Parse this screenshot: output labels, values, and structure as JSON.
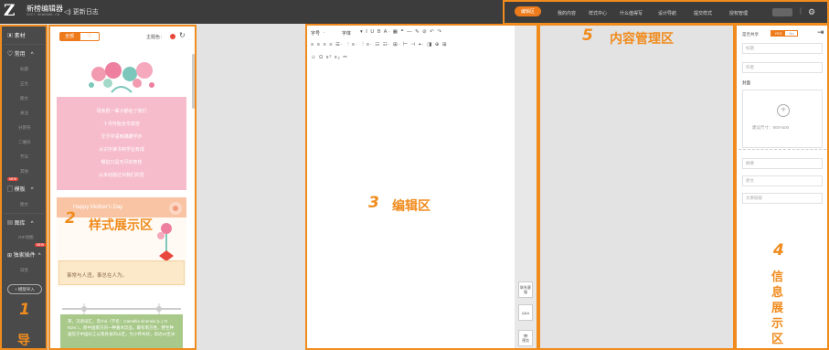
{
  "topbar": {
    "logo_text": "Z",
    "app_name": "新榜编辑器",
    "app_domain": "EDIT.NEWRANK.CN",
    "changelog_label": "更新日志"
  },
  "nav": {
    "items": [
      {
        "label": "编辑区",
        "active": true
      },
      {
        "label": "我的内容"
      },
      {
        "label": "样式中心"
      },
      {
        "label": "什么值得写"
      },
      {
        "label": "设计导航"
      },
      {
        "label": "提交样式"
      },
      {
        "label": "授权管理"
      }
    ],
    "separator": "|"
  },
  "sidebar": {
    "material_label": "素材",
    "common_label": "常用",
    "common_items": [
      "标题",
      "正文",
      "图文",
      "关注",
      "分割符",
      "二维码",
      "节日",
      "其他"
    ],
    "template_label": "模板",
    "template_new": "NEW",
    "template_items": [
      "图文"
    ],
    "gallery_label": "图库",
    "gallery_items": [
      "GIF动图"
    ],
    "plugin_label": "独家插件",
    "plugin_new": "NEW",
    "plugin_items": [
      "日签"
    ],
    "import_label": "+ 模版导入",
    "area_num": "1",
    "area_label_part": "导"
  },
  "styles_panel": {
    "tab_all": "全部",
    "tab_fav": "♡",
    "theme_label": "主题色：",
    "theme_color": "#e8473c",
    "area_num": "2",
    "area_label": "样式展示区",
    "card1_poem": [
      "母亲把一辈子都给了我们",
      "十月怀胎含辛茹苦",
      "牙牙学语到蹒跚学步",
      "从识字读书到学业有成",
      "哪怕只是无尽的牵挂",
      "从未动摇过对我们的爱"
    ],
    "card2_title": "Happy Mother's Day",
    "card2_text": "事常与人违，事总在人为。",
    "card3_text": "茶，汉语词汇，音chá（学名：Camellia sinensis (L.) O. Ktze.），原中国南方的一种嘉木饮品，最有南方性，野生种遍见于中国长江以南各省的山区，为小乔木状，高达15至米"
  },
  "editor": {
    "toolbar_row1_font": "字号",
    "toolbar_row1_family": "字体",
    "toolbar_row1_icons": "▾ I U B A· ▦ ❝ — ✎ ⊘ ↶ ↷",
    "toolbar_row2_icons": "≡ ≡ ≡ ≡ ☰· ⋮≡· ⋮≡· ☷ ☷· ⊞· ⊢ ⊣ ⌖· ◨ ⊕ ⊞",
    "toolbar_row3_icons": "☺ Ω x² x₂ ⎓",
    "area_num": "3",
    "area_label": "编辑区",
    "side_btn1": "联系客服",
    "side_btn2": "Q&A",
    "side_btn3": "预览"
  },
  "content_area": {
    "area_num": "5",
    "area_label": "内容管理区"
  },
  "info_panel": {
    "share_label": "是否共享",
    "yes": "YES",
    "no": "No",
    "title_placeholder": "标题",
    "author_placeholder": "作者",
    "cover_label": "封面",
    "cover_hint": "建议尺寸：900×500",
    "summary_placeholder": "摘要",
    "source_placeholder": "原文",
    "link_placeholder": "文章链接",
    "area_num": "4",
    "area_label": [
      "信",
      "息",
      "展",
      "示",
      "区"
    ]
  }
}
